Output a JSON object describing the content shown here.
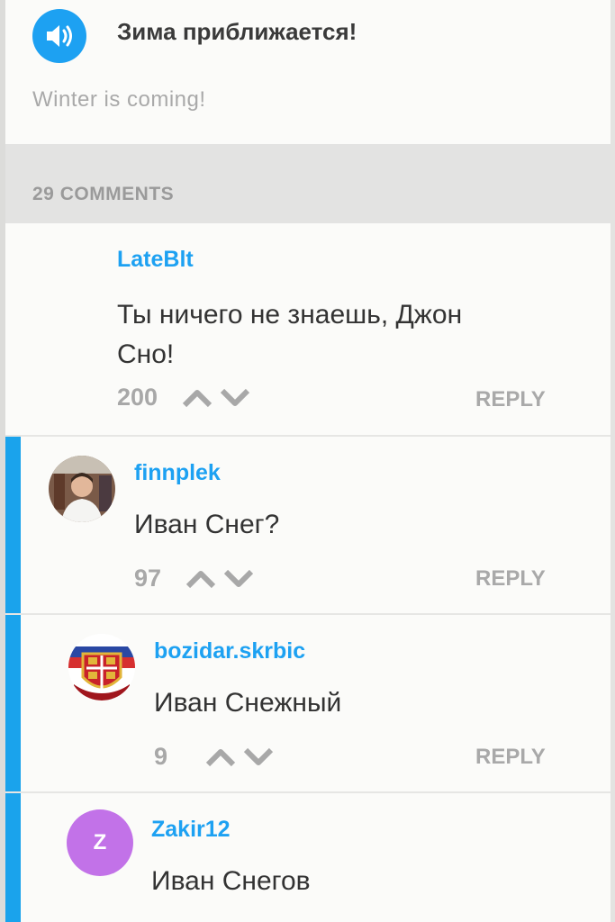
{
  "header": {
    "phrase": "Зима приближается!",
    "translation": "Winter is coming!",
    "speaker_icon": "speaker-icon",
    "accent_color": "#1da1f2"
  },
  "comments_header": {
    "count_label": "29 COMMENTS"
  },
  "comments": [
    {
      "username": "LateBlt",
      "text": "Ты ничего не знаешь, Джон Сно!",
      "votes": "200",
      "reply_label": "REPLY"
    },
    {
      "username": "finnplek",
      "text": "Иван Снег?",
      "votes": "97",
      "reply_label": "REPLY",
      "avatar": "photo-avatar"
    },
    {
      "username": "bozidar.skrbic",
      "text": "Иван Снежный",
      "votes": "9",
      "reply_label": "REPLY",
      "avatar": "coat-of-arms-avatar"
    },
    {
      "username": "Zakir12",
      "text": "Иван Снегов",
      "avatar_letter": "Z",
      "avatar_color": "#c272e8"
    }
  ],
  "colors": {
    "thread_bar": "#1aa3ec",
    "username": "#1da1f2",
    "muted": "#a9a9a9"
  }
}
